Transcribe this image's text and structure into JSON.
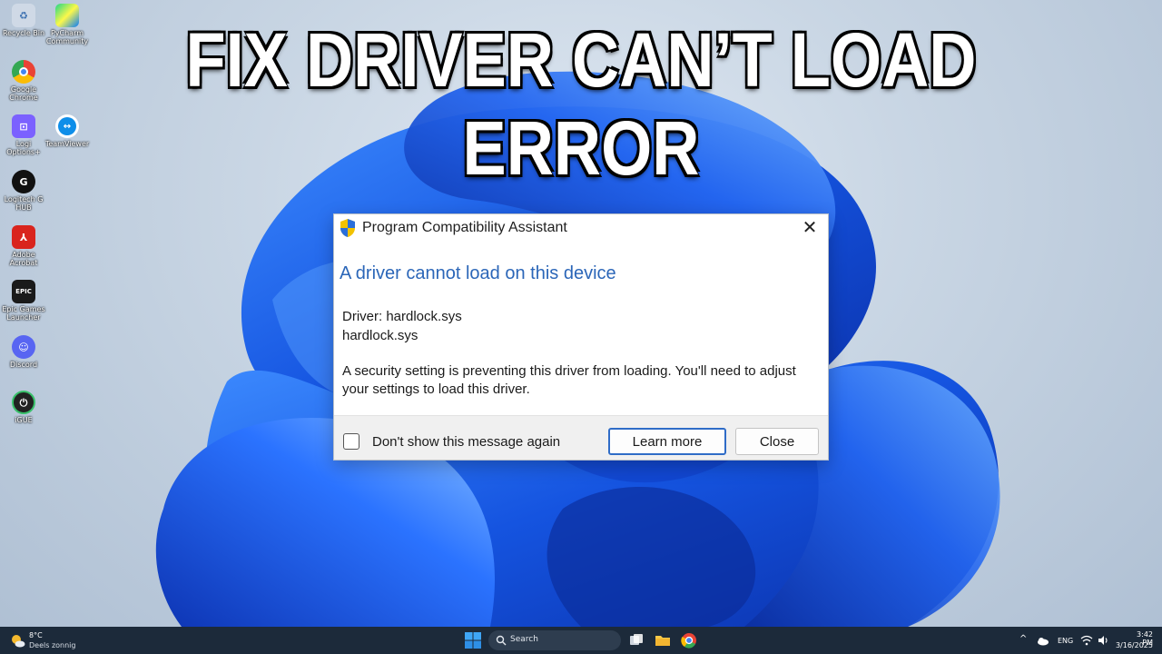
{
  "headline": "FIX DRIVER CAN’T LOAD ERROR",
  "desktop_icons": [
    {
      "label": "Recycle Bin",
      "icon": "recycle-bin-icon"
    },
    {
      "label": "PyCharm Community",
      "icon": "pycharm-icon"
    },
    {
      "label": "Google Chrome",
      "icon": "chrome-icon"
    },
    {
      "label": "Logi Options+",
      "icon": "logi-options-icon"
    },
    {
      "label": "TeamViewer",
      "icon": "teamviewer-icon"
    },
    {
      "label": "Logitech G HUB",
      "icon": "logitech-ghub-icon"
    },
    {
      "label": "Adobe Acrobat",
      "icon": "acrobat-icon"
    },
    {
      "label": "Epic Games Launcher",
      "icon": "epic-games-icon",
      "glyph": "EPIC"
    },
    {
      "label": "Discord",
      "icon": "discord-icon"
    },
    {
      "label": "iGUE",
      "icon": "igue-icon"
    }
  ],
  "dialog": {
    "title": "Program Compatibility Assistant",
    "close_glyph": "✕",
    "heading": "A driver cannot load on this device",
    "driver_line": "Driver: hardlock.sys",
    "driver_file": "hardlock.sys",
    "message": "A security setting is preventing this driver from loading. You'll need to adjust your settings to load this driver.",
    "checkbox_label": "Don't show this message again",
    "checkbox_checked": false,
    "learn_more_label": "Learn more",
    "close_label": "Close",
    "heading_color": "#2b66b8"
  },
  "taskbar": {
    "weather_temp": "8°C",
    "weather_desc": "Deels zonnig",
    "search_placeholder": "Search",
    "language": "ENG",
    "time": "3:42 PM",
    "date": "3/16/2025",
    "tray_chevron": "^"
  },
  "colors": {
    "wallpaper_blue": "#1f5fe0",
    "taskbar_bg": "#1c2a3a",
    "accent": "#2f6cc7"
  }
}
